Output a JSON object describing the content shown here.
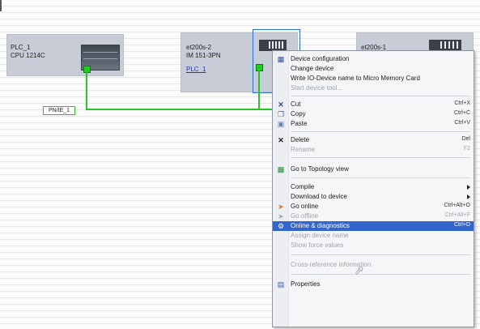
{
  "network_view": {
    "devices": [
      {
        "name": "PLC_1",
        "subtitle": "CPU 1214C"
      },
      {
        "name": "et200s-2",
        "subtitle": "IM 151-3PN",
        "link": "PLC_1"
      },
      {
        "name": "et200s-1"
      }
    ],
    "network_label": "PN/IE_1",
    "colors": {
      "network": "#27c427",
      "device_bg": "#c8ccd6",
      "selection": "#2b6fd6",
      "menu_highlight": "#3366cc"
    }
  },
  "context_menu": {
    "items": [
      {
        "label": "Device configuration",
        "icon": "device-config-icon"
      },
      {
        "label": "Change device"
      },
      {
        "label": "Write IO-Device name to Micro Memory Card"
      },
      {
        "label": "Start device tool...",
        "disabled": true
      },
      {
        "label": "Cut",
        "shortcut": "Ctrl+X",
        "icon": "cut-icon"
      },
      {
        "label": "Copy",
        "shortcut": "Ctrl+C",
        "icon": "copy-icon"
      },
      {
        "label": "Paste",
        "shortcut": "Ctrl+V",
        "icon": "paste-icon"
      },
      {
        "label": "Delete",
        "shortcut": "Del",
        "icon": "delete-icon"
      },
      {
        "label": "Rename",
        "shortcut": "F2",
        "disabled": true
      },
      {
        "label": "Go to Topology view",
        "icon": "topology-icon"
      },
      {
        "label": "Compile",
        "submenu": true
      },
      {
        "label": "Download to device",
        "submenu": true
      },
      {
        "label": "Go online",
        "shortcut": "Ctrl+Alt+O",
        "icon": "go-online-icon"
      },
      {
        "label": "Go offline",
        "shortcut": "Ctrl+Alt+F",
        "icon": "go-offline-icon",
        "disabled": true
      },
      {
        "label": "Online & diagnostics",
        "shortcut": "Ctrl+D",
        "icon": "diagnostics-icon",
        "highlighted": true
      },
      {
        "label": "Assign device name",
        "disabled": true
      },
      {
        "label": "Show force values",
        "disabled": true
      },
      {
        "label": "Cross-reference information",
        "disabled": true
      },
      {
        "label": "Properties",
        "icon": "properties-icon"
      }
    ]
  }
}
